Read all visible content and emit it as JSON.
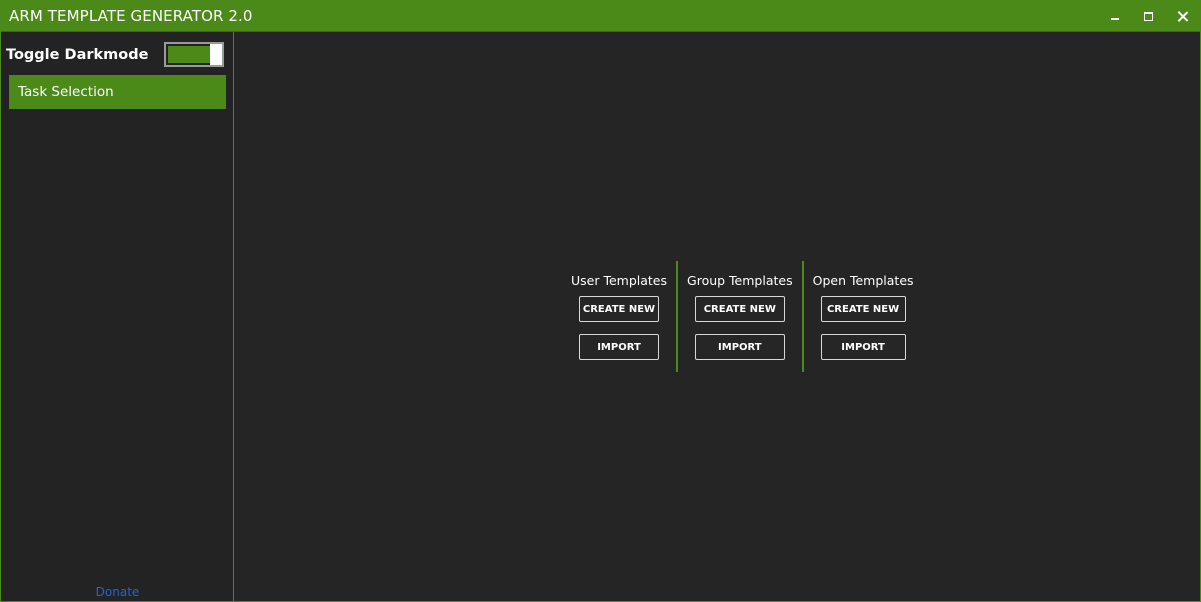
{
  "window": {
    "title": "ARM TEMPLATE GENERATOR 2.0",
    "accent": "#4b8a18",
    "controls": [
      "minimize-icon",
      "maximize-icon",
      "close-icon"
    ]
  },
  "sidebar": {
    "toggle_label": "Toggle Darkmode",
    "toggle_on": true,
    "nav_items": [
      {
        "label": "Task Selection",
        "selected": true
      }
    ],
    "donate": "Donate"
  },
  "main": {
    "groups": [
      {
        "title": "User Templates",
        "create": "CREATE NEW",
        "import": "IMPORT"
      },
      {
        "title": "Group Templates",
        "create": "CREATE NEW",
        "import": "IMPORT"
      },
      {
        "title": "Open Templates",
        "create": "CREATE NEW",
        "import": "IMPORT"
      }
    ]
  }
}
